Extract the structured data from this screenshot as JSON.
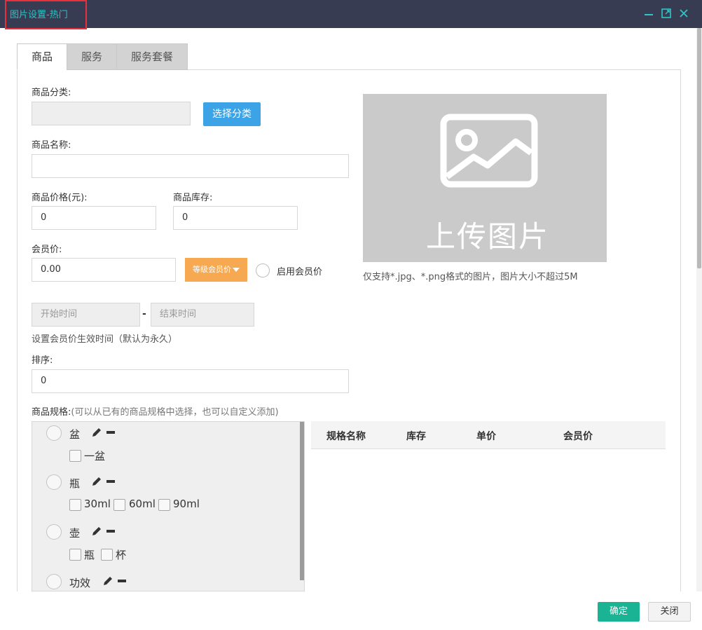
{
  "window": {
    "title": "图片设置-热门",
    "controls": [
      "minimize-icon",
      "maximize-icon",
      "close-icon"
    ]
  },
  "tabs": [
    {
      "label": "商品",
      "active": true
    },
    {
      "label": "服务",
      "active": false
    },
    {
      "label": "服务套餐",
      "active": false
    }
  ],
  "form": {
    "category_label": "商品分类:",
    "category_value": "",
    "choose_category_button": "选择分类",
    "name_label": "商品名称:",
    "name_value": "",
    "price_label": "商品价格(元):",
    "price_value": "0",
    "stock_label": "商品库存:",
    "stock_value": "0",
    "member_price_label": "会员价:",
    "member_price_value": "0.00",
    "level_price_button": "等级会员价",
    "enable_member_price_label": "启用会员价",
    "start_time_placeholder": "开始时间",
    "time_separator": "-",
    "end_time_placeholder": "结束时间",
    "time_hint": "设置会员价生效时间（默认为永久）",
    "sort_label": "排序:",
    "sort_value": "0",
    "spec_label": "商品规格:",
    "spec_hint": "(可以从已有的商品规格中选择，也可以自定义添加)"
  },
  "upload": {
    "label": "上传图片",
    "tip": "仅支持*.jpg、*.png格式的图片，图片大小不超过5M",
    "icon": "image-icon"
  },
  "spec_groups": [
    {
      "name": "盆",
      "options": [
        "一盆"
      ]
    },
    {
      "name": "瓶",
      "options": [
        "30ml",
        "60ml",
        "90ml"
      ]
    },
    {
      "name": "壶",
      "options": [
        "瓶",
        "杯"
      ]
    },
    {
      "name": "功效",
      "options": []
    }
  ],
  "spec_table": {
    "headers": [
      "规格名称",
      "库存",
      "单价",
      "会员价"
    ]
  },
  "footer": {
    "ok_button": "确定",
    "close_button": "关闭"
  },
  "colors": {
    "titlebar": "#383c52",
    "title_text": "#26c6c6",
    "highlight_border": "#e8303a",
    "primary_blue": "#3ca3e6",
    "orange": "#f7a952",
    "confirm_green": "#1ab394"
  }
}
